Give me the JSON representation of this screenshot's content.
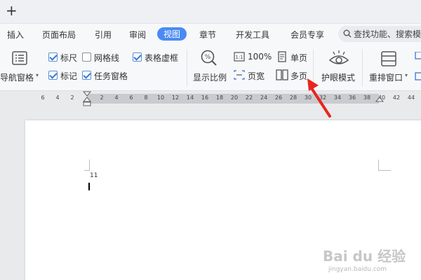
{
  "titlebar": {
    "new_tab_label": "+"
  },
  "tabs": [
    {
      "label": "插入"
    },
    {
      "label": "页面布局"
    },
    {
      "label": "引用"
    },
    {
      "label": "审阅"
    },
    {
      "label": "视图",
      "active": true
    },
    {
      "label": "章节"
    },
    {
      "label": "开发工具"
    },
    {
      "label": "会员专享"
    }
  ],
  "search": {
    "placeholder": "查找功能、搜索模"
  },
  "ribbon": {
    "nav_pane": "导航窗格",
    "ruler": "标尺",
    "gridlines": "网格线",
    "table_gridlines": "表格虚框",
    "marks": "标记",
    "task_pane": "任务窗格",
    "zoom": "显示比例",
    "zoom_100": "100%",
    "page_width": "页宽",
    "single_page": "单页",
    "multi_page": "多页",
    "eye_mode": "护眼模式",
    "rearrange_window": "重排窗口"
  },
  "checkboxes": {
    "ruler": true,
    "gridlines": false,
    "table_gridlines": true,
    "marks": true,
    "task_pane": true
  },
  "ruler_ticks": [
    "6",
    "4",
    "2",
    "2",
    "4",
    "6",
    "8",
    "10",
    "12",
    "14",
    "16",
    "18",
    "20",
    "22",
    "24",
    "26",
    "28",
    "30",
    "32",
    "34",
    "36",
    "38",
    "40",
    "42",
    "44"
  ],
  "document": {
    "page_number": "11"
  },
  "watermark": {
    "brand": "Bai du 经验",
    "url": "jingyan.baidu.com"
  },
  "colors": {
    "accent": "#4a8af4",
    "arrow": "#e8251f"
  }
}
